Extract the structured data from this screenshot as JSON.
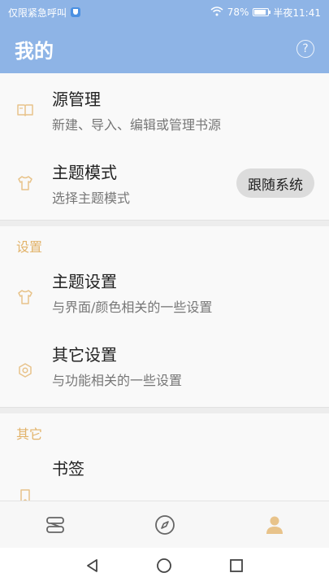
{
  "status_bar": {
    "left_text": "仅限紧急呼叫",
    "battery": "78%",
    "time": "半夜11:41"
  },
  "app_bar": {
    "title": "我的",
    "help_icon": "?"
  },
  "items": {
    "source": {
      "title": "源管理",
      "subtitle": "新建、导入、编辑或管理书源"
    },
    "theme_mode": {
      "title": "主题模式",
      "subtitle": "选择主题模式",
      "value": "跟随系统"
    },
    "theme_settings": {
      "title": "主题设置",
      "subtitle": "与界面/颜色相关的一些设置"
    },
    "other_settings": {
      "title": "其它设置",
      "subtitle": "与功能相关的一些设置"
    },
    "bookmarks": {
      "title": "书签"
    }
  },
  "sections": {
    "settings": "设置",
    "others": "其它"
  },
  "colors": {
    "accent": "#8eb4e6",
    "icon": "#e8c38a",
    "section": "#e2b36a"
  }
}
